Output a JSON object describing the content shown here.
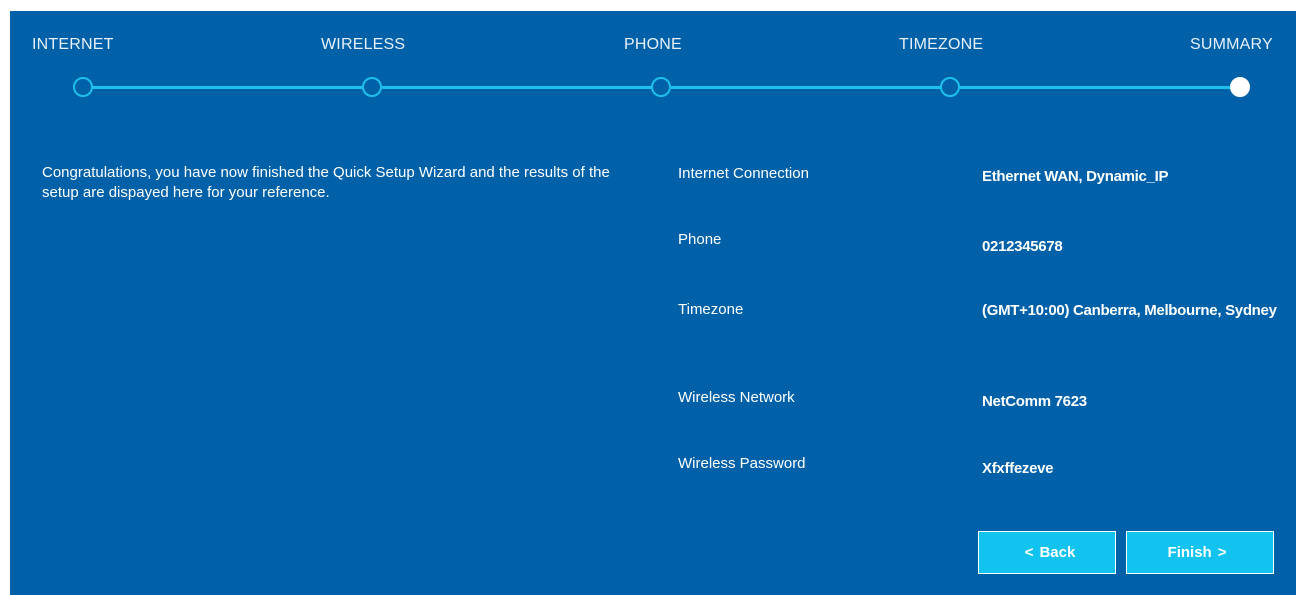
{
  "wizard": {
    "steps": [
      {
        "label": "INTERNET",
        "state": "completed"
      },
      {
        "label": "WIRELESS",
        "state": "completed"
      },
      {
        "label": "PHONE",
        "state": "completed"
      },
      {
        "label": "TIMEZONE",
        "state": "completed"
      },
      {
        "label": "SUMMARY",
        "state": "current"
      }
    ]
  },
  "intro_text": "Congratulations, you have now finished the Quick Setup Wizard and the results of the setup are dispayed here for your reference.",
  "summary": [
    {
      "label": "Internet Connection",
      "value": "Ethernet WAN, Dynamic_IP"
    },
    {
      "label": "Phone",
      "value": "0212345678"
    },
    {
      "label": "Timezone",
      "value": "(GMT+10:00) Canberra, Melbourne, Sydney"
    },
    {
      "label": "Wireless Network",
      "value": "NetComm 7623"
    },
    {
      "label": "Wireless Password",
      "value": "Xfxffezeve"
    }
  ],
  "buttons": {
    "back_label": "Back",
    "back_icon": "chevron-left-icon",
    "finish_label": "Finish",
    "finish_icon": "chevron-right-icon"
  },
  "colors": {
    "panel_background": "#0060a8",
    "progress_line": "#1cc0ec",
    "button_background": "#12c2ef",
    "active_node": "#ffffff"
  }
}
